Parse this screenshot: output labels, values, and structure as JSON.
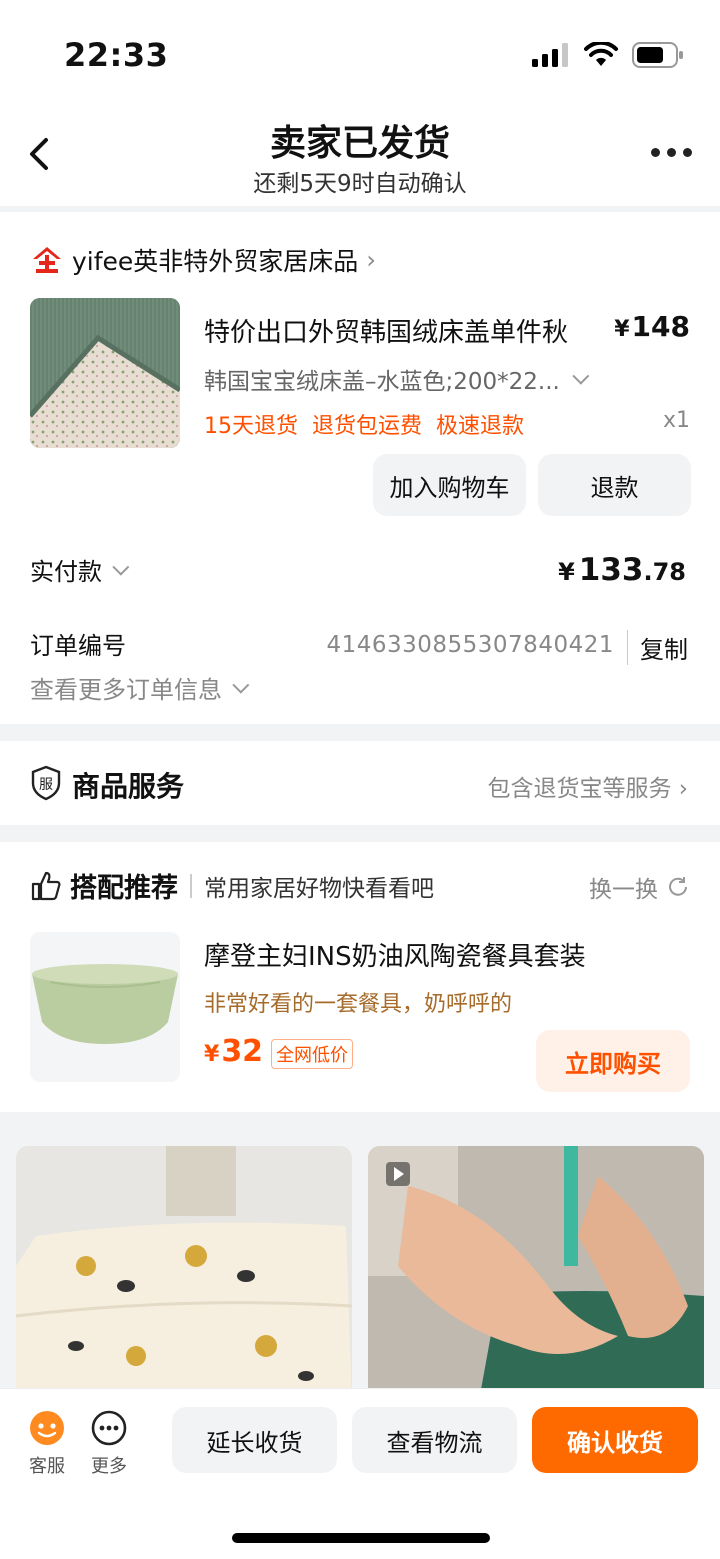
{
  "status": {
    "time": "22:33"
  },
  "nav": {
    "title": "卖家已发货",
    "subtitle": "还剩5天9时自动确认"
  },
  "shop": {
    "name": "yifee英非特外贸家居床品",
    "chevron": "›"
  },
  "product": {
    "title": "特价出口外贸韩国绒床盖单件秋",
    "price_symbol": "¥",
    "price": "148",
    "sku": "韩国宝宝绒床盖–水蓝色;200*22...",
    "tags": [
      "15天退货",
      "退货包运费",
      "极速退款"
    ],
    "qty": "x1",
    "add_cart_label": "加入购物车",
    "refund_label": "退款"
  },
  "payment": {
    "label": "实付款",
    "symbol": "¥",
    "amount_int": "133",
    "amount_dec": ".78"
  },
  "order": {
    "number_label": "订单编号",
    "number": "4146330855307840421",
    "copy_label": "复制",
    "more_label": "查看更多订单信息"
  },
  "service": {
    "icon_text": "服",
    "title": "商品服务",
    "right_text": "包含退货宝等服务 ›"
  },
  "recommend": {
    "title": "搭配推荐",
    "subtitle": "常用家居好物快看看吧",
    "swap_label": "换一换",
    "item": {
      "name": "摩登主妇INS奶油风陶瓷餐具套装",
      "desc": "非常好看的一套餐具，奶呼呼的",
      "price_symbol": "¥",
      "price": "32",
      "badge": "全网低价",
      "buy_label": "立即购买"
    }
  },
  "bottom": {
    "service_label": "客服",
    "more_label": "更多",
    "extend_label": "延长收货",
    "logistics_label": "查看物流",
    "confirm_label": "确认收货"
  },
  "colors": {
    "accent": "#ff5000",
    "confirm_button": "#ff6a00",
    "gray_button": "#f2f3f5",
    "shop_logo_red": "#e4261b"
  }
}
